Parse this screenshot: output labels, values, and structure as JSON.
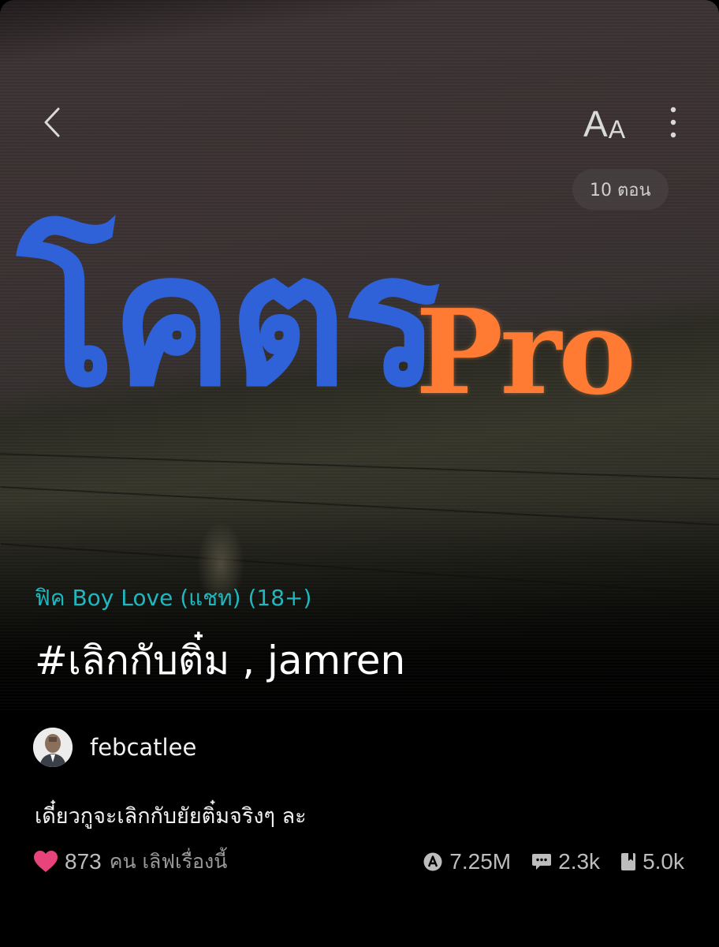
{
  "cover": {
    "logo_thai": "โคตร",
    "logo_pro": "Pro"
  },
  "toolbar": {
    "font_size_big": "A",
    "font_size_small": "A"
  },
  "episodes_badge": "10 ตอน",
  "story": {
    "category": "ฟิค Boy Love (แชท) (18+)",
    "title": "#เลิกกับติ๋ม , jamren",
    "author": "febcatlee",
    "description": "เดี๋ยวกูจะเลิกกับยัยติ๋มจริงๆ ละ"
  },
  "stats": {
    "likes_count": "873",
    "likes_text": "คน เลิฟเรื่องนี้",
    "views": "7.25M",
    "comments": "2.3k",
    "bookmarks": "5.0k"
  },
  "colors": {
    "category": "#1fb8bf",
    "heart": "#e8437a",
    "logo_blue": "#2f61d8",
    "logo_orange": "#ff7b33"
  },
  "icons": [
    "back-chevron-icon",
    "font-size-icon",
    "more-vertical-icon",
    "heart-icon",
    "view-count-icon",
    "comment-icon",
    "bookmark-icon"
  ]
}
